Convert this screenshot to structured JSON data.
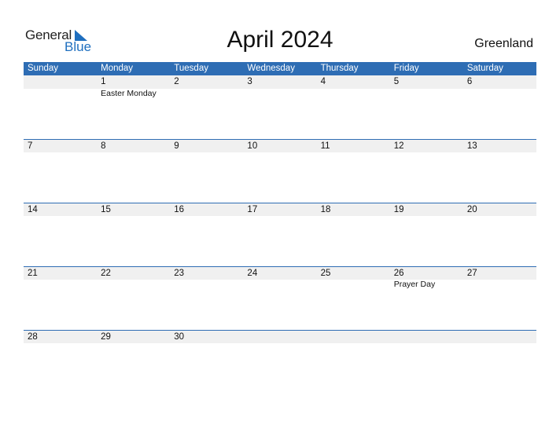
{
  "logo": {
    "line1": "General",
    "line2": "Blue",
    "brand_color": "#1f6fbf"
  },
  "title": "April 2024",
  "country": "Greenland",
  "header_color": "#2e6db4",
  "weekdays": [
    "Sunday",
    "Monday",
    "Tuesday",
    "Wednesday",
    "Thursday",
    "Friday",
    "Saturday"
  ],
  "weeks": [
    {
      "days": [
        "",
        "1",
        "2",
        "3",
        "4",
        "5",
        "6"
      ],
      "notes": [
        "",
        "Easter Monday",
        "",
        "",
        "",
        "",
        ""
      ]
    },
    {
      "days": [
        "7",
        "8",
        "9",
        "10",
        "11",
        "12",
        "13"
      ],
      "notes": [
        "",
        "",
        "",
        "",
        "",
        "",
        ""
      ]
    },
    {
      "days": [
        "14",
        "15",
        "16",
        "17",
        "18",
        "19",
        "20"
      ],
      "notes": [
        "",
        "",
        "",
        "",
        "",
        "",
        ""
      ]
    },
    {
      "days": [
        "21",
        "22",
        "23",
        "24",
        "25",
        "26",
        "27"
      ],
      "notes": [
        "",
        "",
        "",
        "",
        "",
        "Prayer Day",
        ""
      ]
    },
    {
      "days": [
        "28",
        "29",
        "30",
        "",
        "",
        "",
        ""
      ],
      "notes": [
        "",
        "",
        "",
        "",
        "",
        "",
        ""
      ]
    }
  ]
}
